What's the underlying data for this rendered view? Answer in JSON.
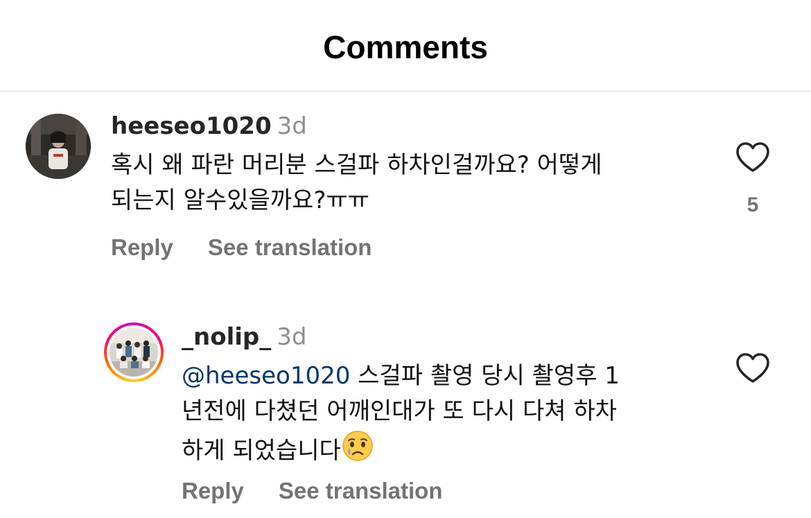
{
  "header": {
    "title": "Comments"
  },
  "comments": [
    {
      "username": "heeseo1020",
      "time": "3d",
      "lines": [
        "혹시 왜 파란 머리분 스걸파 하차인걸까요? 어떻게",
        "되는지 알수있을까요?ㅠㅠ"
      ],
      "likes": "5",
      "reply_label": "Reply",
      "translate_label": "See translation"
    },
    {
      "username": "_nolip_",
      "time": "3d",
      "mention": "@heeseo1020",
      "line1_rest": " 스걸파 촬영 당시 촬영후 1",
      "line2": "년전에 다쳤던 어깨인대가 또 다시 다쳐 하차",
      "line3": "하게 되었습니다",
      "emoji": "crying-face",
      "reply_label": "Reply",
      "translate_label": "See translation"
    }
  ]
}
